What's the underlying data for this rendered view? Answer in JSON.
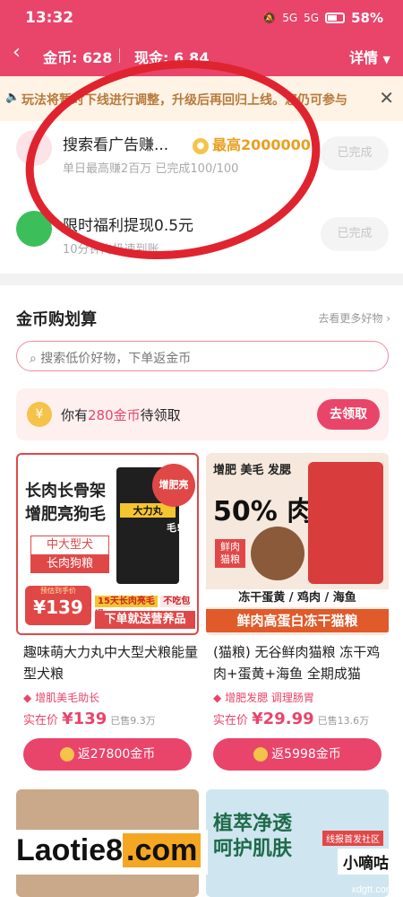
{
  "status_bar": {
    "time": "13:32",
    "battery": "58%",
    "signal1": "5G",
    "signal2": "5G"
  },
  "header": {
    "coin_label": "金币: 628",
    "cash_label": "现金: 6.84",
    "detail_label": "详情"
  },
  "notice": {
    "text": "玩法将暂时下线进行调整，升级后再回归上线。您仍可参与"
  },
  "tasks": [
    {
      "title": "搜索看广告赚...",
      "badge": "最高2000000",
      "subtitle": "单日最高赚2百万 已完成100/100",
      "button": "已完成"
    },
    {
      "title": "限时福利提现0.5元",
      "badge": "",
      "subtitle": "10分钟内极速到账",
      "button": "已完成"
    }
  ],
  "section": {
    "title": "金币购划算",
    "more": "去看更多好物 ›",
    "search_placeholder": "搜索低价好物，下单返金币"
  },
  "claim": {
    "prefix": "你有",
    "amount": "280金币",
    "suffix": "待领取",
    "button": "去领取",
    "icon": "¥"
  },
  "products": [
    {
      "img_lines": [
        "长肉长骨架",
        "增肥亮狗毛"
      ],
      "img_badge1": "中大型犬",
      "img_badge2": "长肉狗粮",
      "img_sticker": "增肥亮毛!",
      "img_pack": "大力丸",
      "img_price_label": "预估到手价",
      "img_price": "¥139",
      "img_promo1": "15天长肉亮毛",
      "img_promo2": "不吃包退",
      "img_promo3": "下单就送营养品",
      "name": "趣味萌大力丸中大型犬粮能量型犬粮",
      "tag": "增肌美毛助长",
      "price_label": "实在价",
      "price": "¥139",
      "sold": "已售9.3万",
      "button": "返27800金币"
    },
    {
      "img_top": "增肥 美毛 发腮",
      "img_big": "50% 肉",
      "img_side": "鲜肉猫粮",
      "img_line1": "冻干蛋黄 / 鸡肉 / 海鱼",
      "img_line2": "鲜肉高蛋白冻干猫粮",
      "name": "(猫粮) 无谷鲜肉猫粮 冻干鸡肉+蛋黄+海鱼 全期成猫",
      "tag": "增肥发腮  调理肠胃",
      "price_label": "实在价",
      "price": "¥29.99",
      "sold": "已售13.6万",
      "button": "返5998金币"
    }
  ],
  "bottom_cards": {
    "right_line1": "植萃净透",
    "right_line2": "呵护肌肤",
    "right_tag": "线报首发社区"
  },
  "watermark": {
    "logo_a": "Laotie8",
    "logo_b": ".com",
    "brand": "小嘀咕",
    "site": "xdgtt.com"
  },
  "colors": {
    "accent": "#e9446a",
    "gold": "#f6c34a",
    "circle": "#e0242f"
  }
}
